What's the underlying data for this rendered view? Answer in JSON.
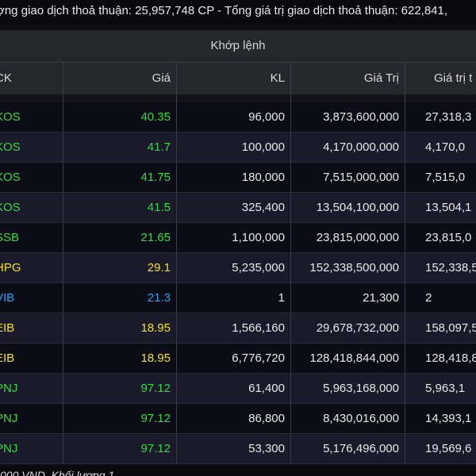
{
  "topbar": {
    "text": "ợng giao dịch thoả thuận: 25,957,748 CP - Tổng giá trị giao dịch thoả thuận: 622,841,"
  },
  "table": {
    "group_header": "Khớp lệnh",
    "headers": [
      "CK",
      "Giá",
      "KL",
      "Giá Trị",
      "Giá trị t"
    ],
    "rows": [
      {
        "ck": "KOS",
        "gia": "40.35",
        "kl": "96,000",
        "gia_tri": "3,873,600,000",
        "gia_tri_t": "27,318,3",
        "color": "#2fdc40"
      },
      {
        "ck": "KOS",
        "gia": "41.7",
        "kl": "100,000",
        "gia_tri": "4,170,000,000",
        "gia_tri_t": "4,170,0",
        "color": "#2fdc40"
      },
      {
        "ck": "KOS",
        "gia": "41.75",
        "kl": "180,000",
        "gia_tri": "7,515,000,000",
        "gia_tri_t": "7,515,0",
        "color": "#2fdc40"
      },
      {
        "ck": "KOS",
        "gia": "41.5",
        "kl": "325,400",
        "gia_tri": "13,504,100,000",
        "gia_tri_t": "13,504,1",
        "color": "#2fdc40"
      },
      {
        "ck": "SSB",
        "gia": "21.65",
        "kl": "1,100,000",
        "gia_tri": "23,815,000,000",
        "gia_tri_t": "23,815,0",
        "color": "#2fdc40"
      },
      {
        "ck": "HPG",
        "gia": "29.1",
        "kl": "5,235,000",
        "gia_tri": "152,338,500,000",
        "gia_tri_t": "152,338,5",
        "color": "#f0e020"
      },
      {
        "ck": "VIB",
        "gia": "21.3",
        "kl": "1",
        "gia_tri": "21,300",
        "gia_tri_t": "2",
        "color": "#2aa0f0"
      },
      {
        "ck": "EIB",
        "gia": "18.95",
        "kl": "1,566,160",
        "gia_tri": "29,678,732,000",
        "gia_tri_t": "158,097,5",
        "color": "#f0e020"
      },
      {
        "ck": "EIB",
        "gia": "18.95",
        "kl": "6,776,720",
        "gia_tri": "128,418,844,000",
        "gia_tri_t": "128,418,8",
        "color": "#f0e020"
      },
      {
        "ck": "PNJ",
        "gia": "97.12",
        "kl": "61,400",
        "gia_tri": "5,963,168,000",
        "gia_tri_t": "5,963,1",
        "color": "#2fdc40"
      },
      {
        "ck": "PNJ",
        "gia": "97.12",
        "kl": "86,800",
        "gia_tri": "8,430,016,000",
        "gia_tri_t": "14,393,1",
        "color": "#2fdc40"
      },
      {
        "ck": "PNJ",
        "gia": "97.12",
        "kl": "53,300",
        "gia_tri": "5,176,496,000",
        "gia_tri_t": "19,569,6",
        "color": "#2fdc40"
      }
    ]
  },
  "bottom": {
    "text": "000 VND. Khối lượng 1"
  }
}
